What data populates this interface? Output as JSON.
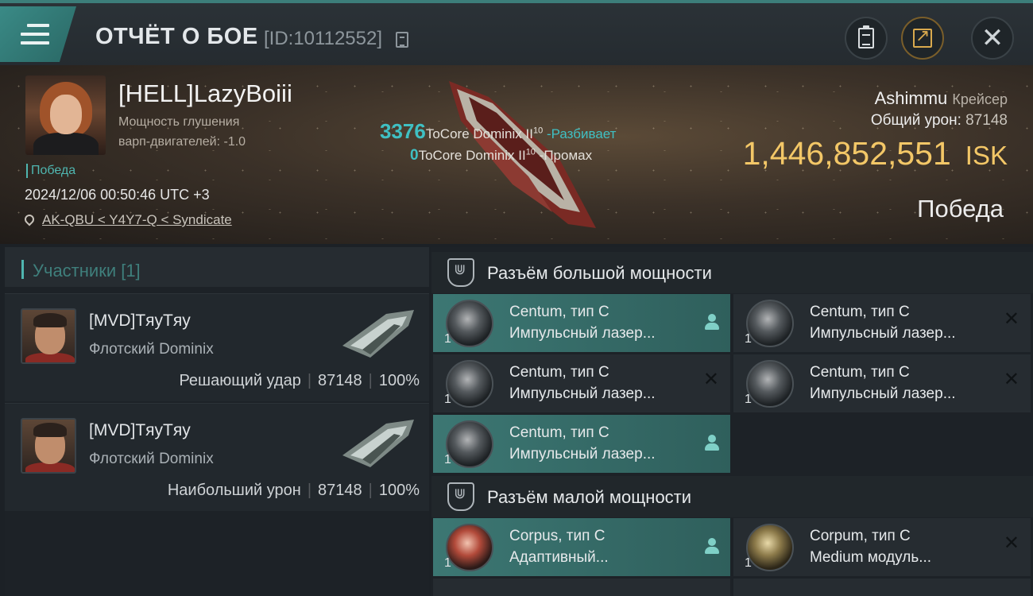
{
  "header": {
    "title": "ОТЧЁТ О БОЕ",
    "report_id": "[ID:10112552]"
  },
  "killer": {
    "name": "[HELL]LazyBoiii",
    "ewar_line1": "Мощность глушения",
    "ewar_line2": "варп-двигателей: -1.0",
    "result_tag": "Победа",
    "datetime": "2024/12/06 00:50:46 UTC +3",
    "location": "AK-QBU < Y4Y7-Q < Syndicate"
  },
  "combat": {
    "hit_value": "3376",
    "hit_weapon": "ToCore Dominix II",
    "hit_level": "10",
    "hit_action": "-Разбивает",
    "miss_value": "0",
    "miss_weapon": "ToCore Dominix II",
    "miss_level": "10",
    "miss_action": "-Промах"
  },
  "victim": {
    "name": "Ashimmu",
    "ship_class": "Крейсер",
    "damage_label": "Общий урон:",
    "damage_value": "87148",
    "isk_value": "1,446,852,551",
    "isk_unit": "ISK",
    "result": "Победа"
  },
  "participants": {
    "header": "Участники [1]",
    "cards": [
      {
        "name": "[MVD]TяyTяy",
        "ship": "Флотский Dominix",
        "role": "Решающий удар",
        "damage": "87148",
        "percent": "100%"
      },
      {
        "name": "[MVD]TяyTяy",
        "ship": "Флотский Dominix",
        "role": "Наибольший урон",
        "damage": "87148",
        "percent": "100%"
      }
    ]
  },
  "high_slots": {
    "title": "Разъём большой мощности",
    "modules": [
      {
        "name": "Centum, тип C",
        "desc": "Импульсный лазер...",
        "qty": "1",
        "state": "dropped",
        "icon": "laser-module-icon"
      },
      {
        "name": "Centum, тип C",
        "desc": "Импульсный лазер...",
        "qty": "1",
        "state": "destroyed",
        "icon": "laser-module-icon"
      },
      {
        "name": "Centum, тип C",
        "desc": "Импульсный лазер...",
        "qty": "1",
        "state": "destroyed",
        "icon": "laser-module-icon"
      },
      {
        "name": "Centum, тип C",
        "desc": "Импульсный лазер...",
        "qty": "1",
        "state": "destroyed",
        "icon": "laser-module-icon"
      },
      {
        "name": "Centum, тип C",
        "desc": "Импульсный лазер...",
        "qty": "1",
        "state": "dropped",
        "icon": "laser-module-icon"
      }
    ]
  },
  "mid_slots": {
    "title": "Разъём малой мощности",
    "modules": [
      {
        "name": "Corpus, тип C",
        "desc": "Адаптивный...",
        "qty": "1",
        "state": "dropped",
        "icon": "hardener-module-icon"
      },
      {
        "name": "Corpum, тип C",
        "desc": "Medium модуль...",
        "qty": "1",
        "state": "destroyed",
        "icon": "medium-module-icon"
      }
    ]
  },
  "colors": {
    "accent_teal": "#3fc0c3",
    "isk_gold": "#f3c767",
    "dropped_row": "#3c7773"
  }
}
